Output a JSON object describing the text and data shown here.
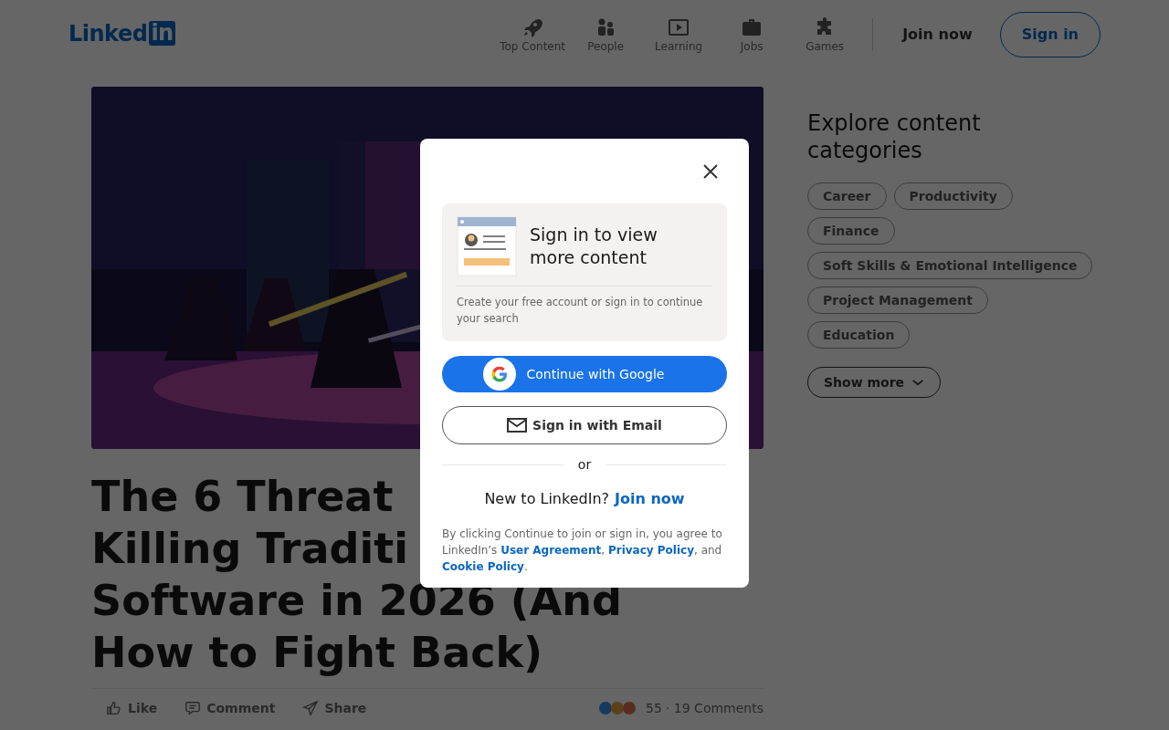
{
  "header": {
    "logo": {
      "text": "Linked",
      "badge": "in"
    },
    "nav": [
      {
        "label": "Top Content"
      },
      {
        "label": "People"
      },
      {
        "label": "Learning"
      },
      {
        "label": "Jobs"
      },
      {
        "label": "Games"
      }
    ],
    "join_now": "Join now",
    "sign_in": "Sign in"
  },
  "article": {
    "title_lines": [
      "The 6 Threat",
      "Killing Traditi",
      "Software in 2026 (And",
      "How to Fight Back)"
    ],
    "actions": [
      {
        "label": "Like"
      },
      {
        "label": "Comment"
      },
      {
        "label": "Share"
      }
    ],
    "reaction_count": "55",
    "comments": "· 19 Comments"
  },
  "sidebar": {
    "title": "Explore content categories",
    "categories": [
      "Career",
      "Productivity",
      "Finance",
      "Soft Skills & Emotional Intelligence",
      "Project Management",
      "Education"
    ],
    "show_more": "Show more"
  },
  "modal": {
    "heading": "Sign in to view more content",
    "subtext": "Create your free account or sign in to continue your search",
    "google_button": "Continue with Google",
    "email_button": "Sign in with Email",
    "divider": "or",
    "new_prompt": "New to LinkedIn?",
    "join_link": "Join now",
    "legal": [
      {
        "kind": "text",
        "text": "By clicking Continue to join or sign in, you agree to LinkedIn’s "
      },
      {
        "kind": "link",
        "text": "User Agreement"
      },
      {
        "kind": "text",
        "text": ", "
      },
      {
        "kind": "link",
        "text": "Privacy Policy"
      },
      {
        "kind": "text",
        "text": ", and "
      },
      {
        "kind": "link",
        "text": "Cookie Policy"
      },
      {
        "kind": "text",
        "text": "."
      }
    ]
  }
}
